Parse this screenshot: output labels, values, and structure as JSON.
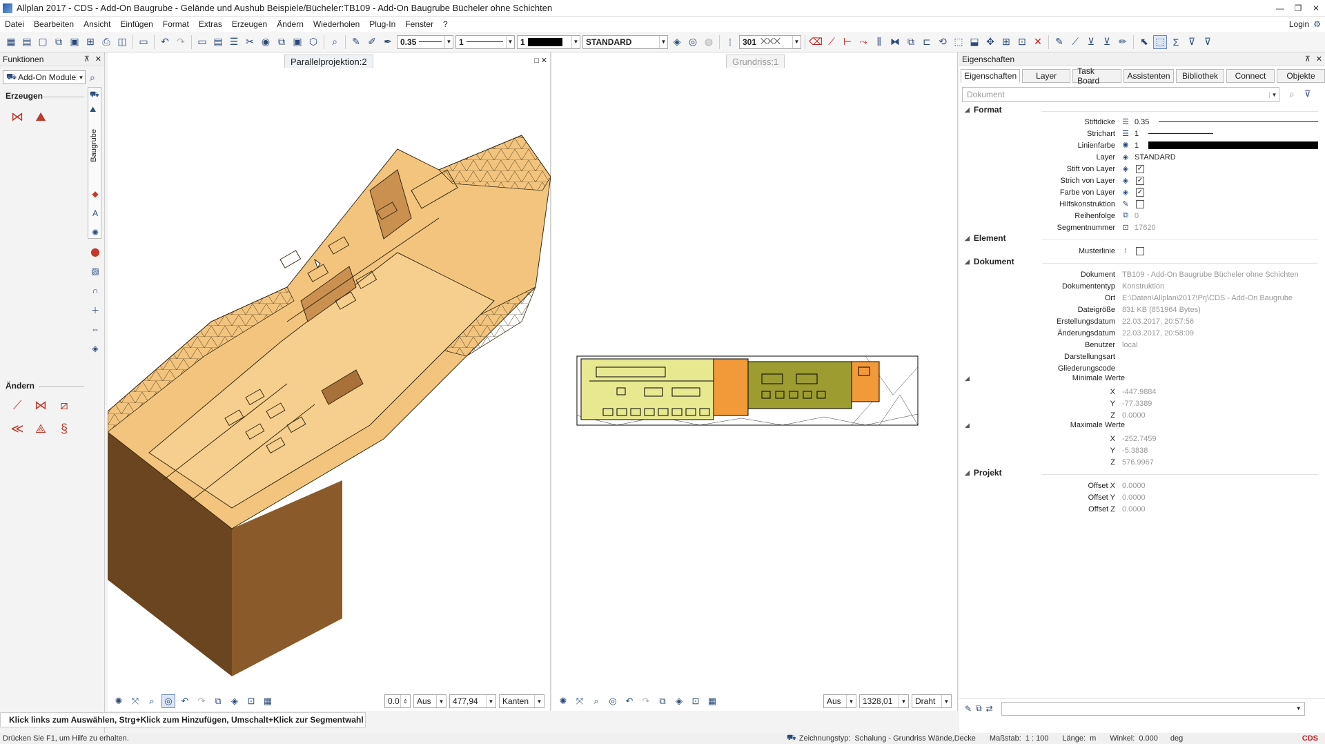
{
  "window": {
    "title": "Allplan 2017 - CDS - Add-On Baugrube - Gelände und Aushub Beispiele/Bücheler:TB109 - Add-On Baugrube Bücheler ohne Schichten",
    "controls": [
      "—",
      "❐",
      "✕"
    ]
  },
  "menu": {
    "items": [
      "Datei",
      "Bearbeiten",
      "Ansicht",
      "Einfügen",
      "Format",
      "Extras",
      "Erzeugen",
      "Ändern",
      "Wiederholen",
      "Plug-In",
      "Fenster",
      "?"
    ],
    "login": "Login"
  },
  "toolbar": {
    "pen": "0.35",
    "line": "1",
    "color": "1",
    "layer": "STANDARD",
    "pattern": "301"
  },
  "left_panel": {
    "title": "Funktionen",
    "module": "Add-On Module",
    "section_create": "Erzeugen",
    "section_modify": "Ändern",
    "side_tab": "Baugrube"
  },
  "viewport1": {
    "tab": "Parallelprojektion:2",
    "footer": {
      "angle": "0.0",
      "mode": "Aus",
      "distance": "477,94",
      "render": "Kanten"
    }
  },
  "viewport2": {
    "tab": "Grundriss:1",
    "footer": {
      "mode": "Aus",
      "distance": "1328,01",
      "render": "Draht"
    }
  },
  "properties": {
    "title": "Eigenschaften",
    "tabs": [
      "Eigenschaften",
      "Layer",
      "Task Board",
      "Assistenten",
      "Bibliothek",
      "Connect",
      "Objekte"
    ],
    "doc_select": "Dokument",
    "groups": {
      "format": "Format",
      "element": "Element",
      "dokument": "Dokument",
      "projekt": "Projekt",
      "min": "Minimale Werte",
      "max": "Maximale Werte"
    },
    "format": {
      "stiftdicke_label": "Stiftdicke",
      "stiftdicke": "0.35",
      "strichart_label": "Strichart",
      "strichart": "1",
      "linienfarbe_label": "Linienfarbe",
      "linienfarbe": "1",
      "layer_label": "Layer",
      "layer": "STANDARD",
      "stift_layer_label": "Stift von Layer",
      "strich_layer_label": "Strich von Layer",
      "farbe_layer_label": "Farbe von Layer",
      "hilfs_label": "Hilfskonstruktion",
      "reihenfolge_label": "Reihenfolge",
      "reihenfolge": "0",
      "segment_label": "Segmentnummer",
      "segment": "17620"
    },
    "element": {
      "musterlinie_label": "Musterlinie"
    },
    "dokument": {
      "dokument_label": "Dokument",
      "dokument": "TB109 - Add-On Baugrube Bücheler ohne Schichten",
      "typ_label": "Dokumententyp",
      "typ": "Konstruktion",
      "ort_label": "Ort",
      "ort": "E:\\Daten\\Allplan\\2017\\Prj\\CDS - Add-On Baugrube",
      "groesse_label": "Dateigröße",
      "groesse": "831 KB (851964 Bytes)",
      "erstellt_label": "Erstellungsdatum",
      "erstellt": "22.03.2017, 20:57:56",
      "geaendert_label": "Änderungsdatum",
      "geaendert": "22.03.2017, 20:58:09",
      "benutzer_label": "Benutzer",
      "benutzer": "local",
      "darstellung_label": "Darstellungsart",
      "gliederung_label": "Gliederungscode",
      "min_x": "-447.9884",
      "min_y": "-77.3389",
      "min_z": "0.0000",
      "max_x": "-252.7459",
      "max_y": "-5.3838",
      "max_z": "576.9967"
    },
    "projekt": {
      "offx_label": "Offset X",
      "offx": "0.0000",
      "offy_label": "Offset Y",
      "offy": "0.0000",
      "offz_label": "Offset Z",
      "offz": "0.0000"
    },
    "axes": {
      "x": "X",
      "y": "Y",
      "z": "Z"
    }
  },
  "status": {
    "hint": "Klick links zum Auswählen, Strg+Klick zum Hinzufügen, Umschalt+Klick zur Segmentwahl",
    "help": "Drücken Sie F1, um Hilfe zu erhalten.",
    "zeichnungstyp_label": "Zeichnungstyp:",
    "zeichnungstyp": "Schalung  -  Grundriss Wände,Decke",
    "massstab_label": "Maßstab:",
    "massstab": "1 : 100",
    "laenge_label": "Länge:",
    "laenge": "m",
    "winkel_label": "Winkel:",
    "winkel": "0.000",
    "winkel_unit": "deg",
    "brand": "CDS"
  }
}
